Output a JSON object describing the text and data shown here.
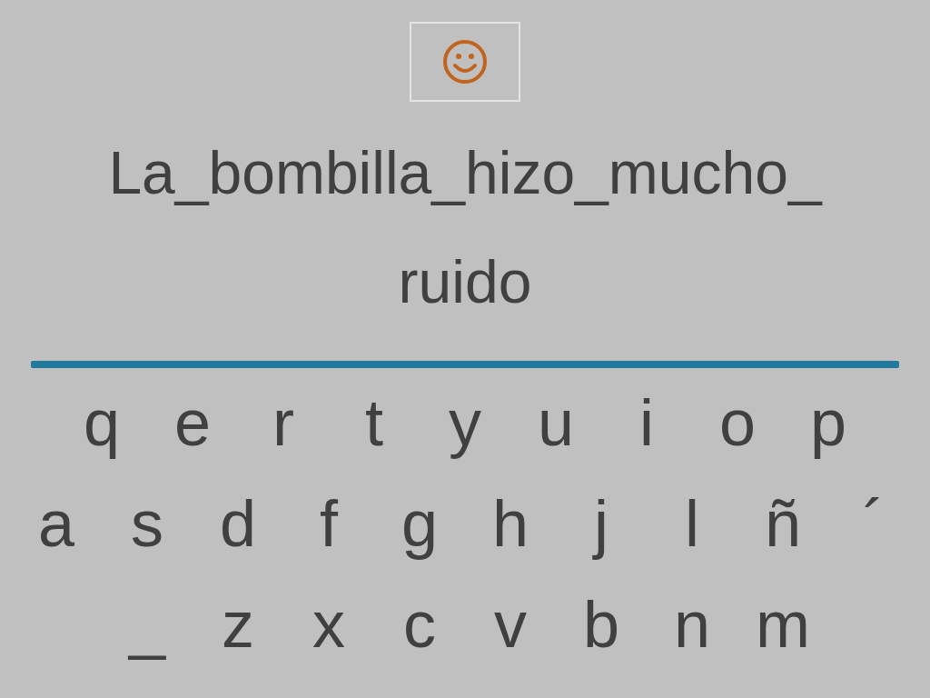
{
  "sentence": {
    "lines": [
      "La_bombilla_hizo_mucho_",
      "ruido"
    ]
  },
  "keyboard": {
    "rows": [
      [
        "q",
        "e",
        "r",
        "t",
        "y",
        "u",
        "i",
        "o",
        "p"
      ],
      [
        "a",
        "s",
        "d",
        "f",
        "g",
        "h",
        "j",
        "l",
        "ñ",
        "´"
      ],
      [
        "_",
        "z",
        "x",
        "c",
        "v",
        "b",
        "n",
        "m"
      ]
    ]
  }
}
